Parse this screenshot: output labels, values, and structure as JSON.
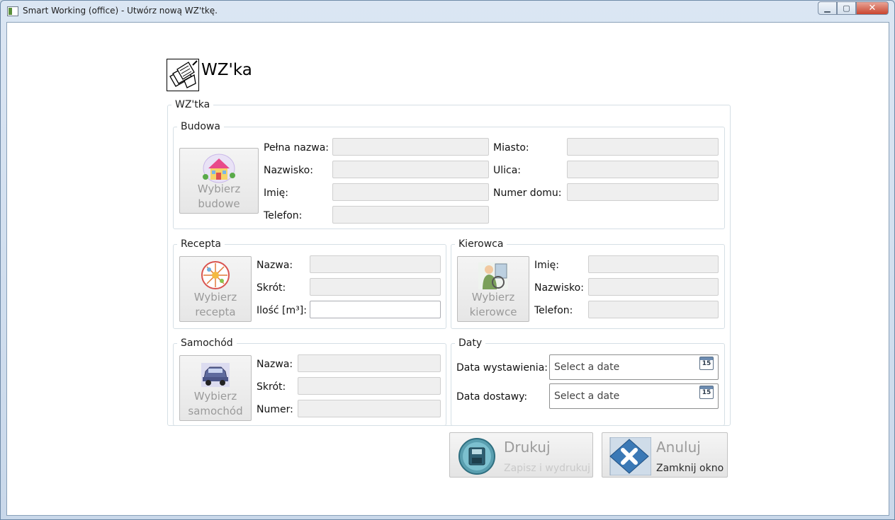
{
  "window": {
    "title": "Smart Working  (office) - Utwórz nową WZ'tkę."
  },
  "header": {
    "title": "WZ'ka"
  },
  "main_group": {
    "legend": "WZ'tka"
  },
  "budowa": {
    "legend": "Budowa",
    "button": {
      "line1": "Wybierz",
      "line2": "budowe"
    },
    "labels": {
      "pelna_nazwa": "Pełna nazwa:",
      "nazwisko": "Nazwisko:",
      "imie": "Imię:",
      "telefon": "Telefon:",
      "miasto": "Miasto:",
      "ulica": "Ulica:",
      "numer_domu": "Numer domu:"
    },
    "values": {
      "pelna_nazwa": "",
      "nazwisko": "",
      "imie": "",
      "telefon": "",
      "miasto": "",
      "ulica": "",
      "numer_domu": ""
    }
  },
  "recepta": {
    "legend": "Recepta",
    "button": {
      "line1": "Wybierz",
      "line2": "recepta"
    },
    "labels": {
      "nazwa": "Nazwa:",
      "skrot": "Skrót:",
      "ilosc": "Ilość [m³]:"
    },
    "values": {
      "nazwa": "",
      "skrot": "",
      "ilosc": ""
    }
  },
  "kierowca": {
    "legend": "Kierowca",
    "button": {
      "line1": "Wybierz",
      "line2": "kierowce"
    },
    "labels": {
      "imie": "Imię:",
      "nazwisko": "Nazwisko:",
      "telefon": "Telefon:"
    },
    "values": {
      "imie": "",
      "nazwisko": "",
      "telefon": ""
    }
  },
  "samochod": {
    "legend": "Samochód",
    "button": {
      "line1": "Wybierz",
      "line2": "samochód"
    },
    "labels": {
      "nazwa": "Nazwa:",
      "skrot": "Skrót:",
      "numer": "Numer:"
    },
    "values": {
      "nazwa": "",
      "skrot": "",
      "numer": ""
    }
  },
  "daty": {
    "legend": "Daty",
    "labels": {
      "wystawienia": "Data wystawienia:",
      "dostawy": "Data dostawy:"
    },
    "placeholder": "Select a date",
    "calendar_day": "15"
  },
  "actions": {
    "drukuj": {
      "label": "Drukuj",
      "sub": "Zapisz i wydrukuj",
      "enabled": false
    },
    "anuluj": {
      "label": "Anuluj",
      "sub": "Zamknij okno",
      "enabled": true
    }
  },
  "colors": {
    "disabled_text": "#9b9b9b",
    "field_bg": "#efefef",
    "anuluj_sub": "#2a2a2a",
    "drukuj_sub": "#c9c9c9"
  }
}
